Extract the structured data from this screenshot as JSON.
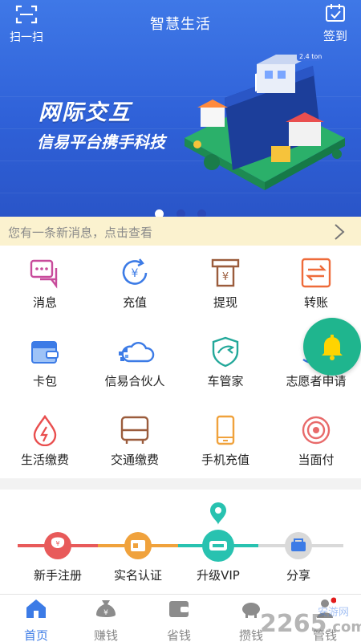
{
  "header": {
    "scan_label": "扫一扫",
    "title": "智慧生活",
    "checkin_label": "签到"
  },
  "banner": {
    "title": "网际交互",
    "subtitle": "信易平台携手科技",
    "carousel": {
      "count": 3,
      "active_index": 0
    }
  },
  "notice": {
    "text": "您有一条新消息，点击查看"
  },
  "functions": [
    {
      "label": "消息",
      "icon": "message-icon"
    },
    {
      "label": "充值",
      "icon": "recharge-icon"
    },
    {
      "label": "提现",
      "icon": "withdraw-icon"
    },
    {
      "label": "转账",
      "icon": "transfer-icon"
    },
    {
      "label": "卡包",
      "icon": "wallet-icon"
    },
    {
      "label": "信易合伙人",
      "icon": "partner-cloud-icon"
    },
    {
      "label": "车管家",
      "icon": "car-steward-icon"
    },
    {
      "label": "志愿者申请",
      "icon": "bell-icon"
    },
    {
      "label": "生活缴费",
      "icon": "water-drop-icon"
    },
    {
      "label": "交通缴费",
      "icon": "bus-icon"
    },
    {
      "label": "手机充值",
      "icon": "phone-icon"
    },
    {
      "label": "当面付",
      "icon": "face-pay-icon"
    }
  ],
  "progress": {
    "steps": [
      {
        "label": "新手注册",
        "icon": "money-bag-icon"
      },
      {
        "label": "实名认证",
        "icon": "id-card-icon"
      },
      {
        "label": "升级VIP",
        "icon": "vip-ticket-icon"
      },
      {
        "label": "分享",
        "icon": "share-bag-icon"
      }
    ],
    "current_step": 3
  },
  "tabbar": {
    "tabs": [
      {
        "label": "首页",
        "icon": "home-icon",
        "active": true
      },
      {
        "label": "赚钱",
        "icon": "money-bag-icon",
        "active": false
      },
      {
        "label": "省钱",
        "icon": "wallet-icon",
        "active": false
      },
      {
        "label": "攒钱",
        "icon": "piggy-bank-icon",
        "active": false
      },
      {
        "label": "管钱",
        "icon": "manage-money-icon",
        "active": false
      }
    ]
  },
  "watermark": {
    "text": "2265",
    "suffix": ".com",
    "small": "安游网"
  },
  "colors": {
    "primary_blue": "#3c7be6",
    "banner_blue": "#2f61d8",
    "notice_bg": "#fbf2cf",
    "fab_green": "#1fb58e",
    "track_red": "#e85a5a",
    "track_orange": "#f0a23c",
    "track_teal": "#28c2b0",
    "track_gray": "#d9d9d9"
  }
}
